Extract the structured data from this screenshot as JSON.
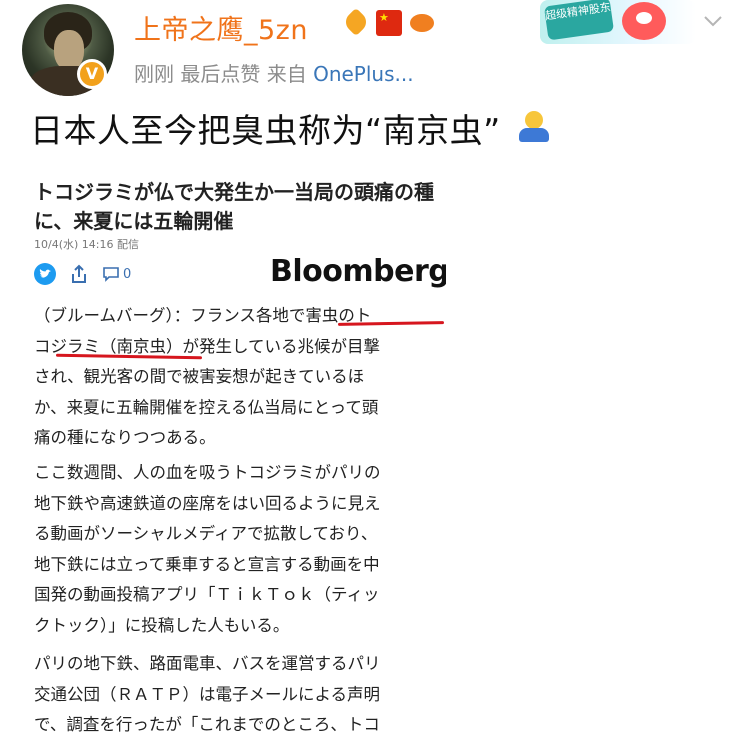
{
  "post": {
    "username": "上帝之鹰_5zn",
    "meta_time": "刚刚",
    "meta_action": "最后点赞",
    "meta_source_prefix": "来自",
    "meta_source": "OnePlus...",
    "avatar_badge": "V",
    "text": "日本人至今把臭虫称为“南京虫”",
    "badges": [
      "heart-badge-icon",
      "china-flag-icon",
      "fish-badge-icon"
    ],
    "promo_text": "超级精神股东"
  },
  "article": {
    "title": "トコジラミが仏で大発生か一当局の頭痛の種に、来夏には五輪開催",
    "date": "10/4(水) 14:16 配信",
    "comment_count": "0",
    "brand": "Bloomberg",
    "paragraphs": [
      [
        "（ブルームバーグ）：フランス各地で害虫のト",
        "コジラミ（南京虫）が発生している兆候が目撃",
        "され、観光客の間で被害妄想が起きているほ",
        "か、来夏に五輪開催を控える仏当局にとって頭",
        "痛の種になりつつある。"
      ],
      [
        "ここ数週間、人の血を吸うトコジラミがパリの",
        "地下鉄や高速鉄道の座席をはい回るように見え",
        "る動画がソーシャルメディアで拡散しており、",
        "地下鉄には立って乗車すると宣言する動画を中",
        "国発の動画投稿アプリ「ＴｉｋＴｏｋ（ティッ",
        "クトック）」に投稿した人もいる。"
      ],
      [
        "パリの地下鉄、路面電車、バスを運営するパリ",
        "交通公団（ＲＡＴＰ）は電子メールによる声明",
        "で、調査を行ったが「これまでのところ、トコ"
      ]
    ]
  },
  "colors": {
    "username": "#f0731a",
    "meta": "#8c8c8c",
    "source_link": "#3a76b8",
    "underline": "#d6161e"
  }
}
